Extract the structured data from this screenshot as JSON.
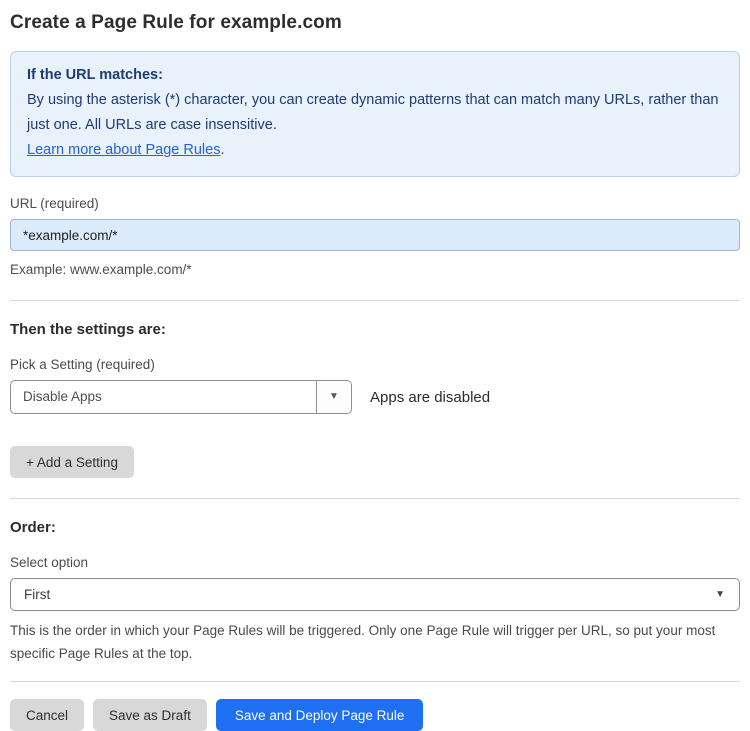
{
  "page": {
    "title": "Create a Page Rule for example.com"
  },
  "info_box": {
    "heading": "If the URL matches:",
    "body": "By using the asterisk (*) character, you can create dynamic patterns that can match many URLs, rather than just one. All URLs are case insensitive.",
    "link_text": "Learn more about Page Rules",
    "link_suffix": "."
  },
  "url_field": {
    "label": "URL (required)",
    "value": "*example.com/*",
    "example": "Example: www.example.com/*"
  },
  "settings": {
    "heading": "Then the settings are:",
    "picker_label": "Pick a Setting (required)",
    "selected_setting": "Disable Apps",
    "status_text": "Apps are disabled",
    "add_button_label": "+ Add a Setting"
  },
  "order": {
    "heading": "Order:",
    "select_label": "Select option",
    "selected_option": "First",
    "help_text": "This is the order in which your Page Rules will be triggered. Only one Page Rule will trigger per URL, so put your most specific Page Rules at the top."
  },
  "footer": {
    "cancel_label": "Cancel",
    "save_draft_label": "Save as Draft",
    "save_deploy_label": "Save and Deploy Page Rule"
  },
  "icons": {
    "dropdown_caret": "▼",
    "select_caret": "▼"
  },
  "colors": {
    "accent_blue": "#1f6ff2",
    "info_bg": "#e9f1fb",
    "info_border": "#b8d3f0",
    "info_text": "#1e3c72",
    "link_blue": "#2263d1",
    "input_bg": "#dcebfc",
    "button_gray": "#d8d8d8"
  }
}
